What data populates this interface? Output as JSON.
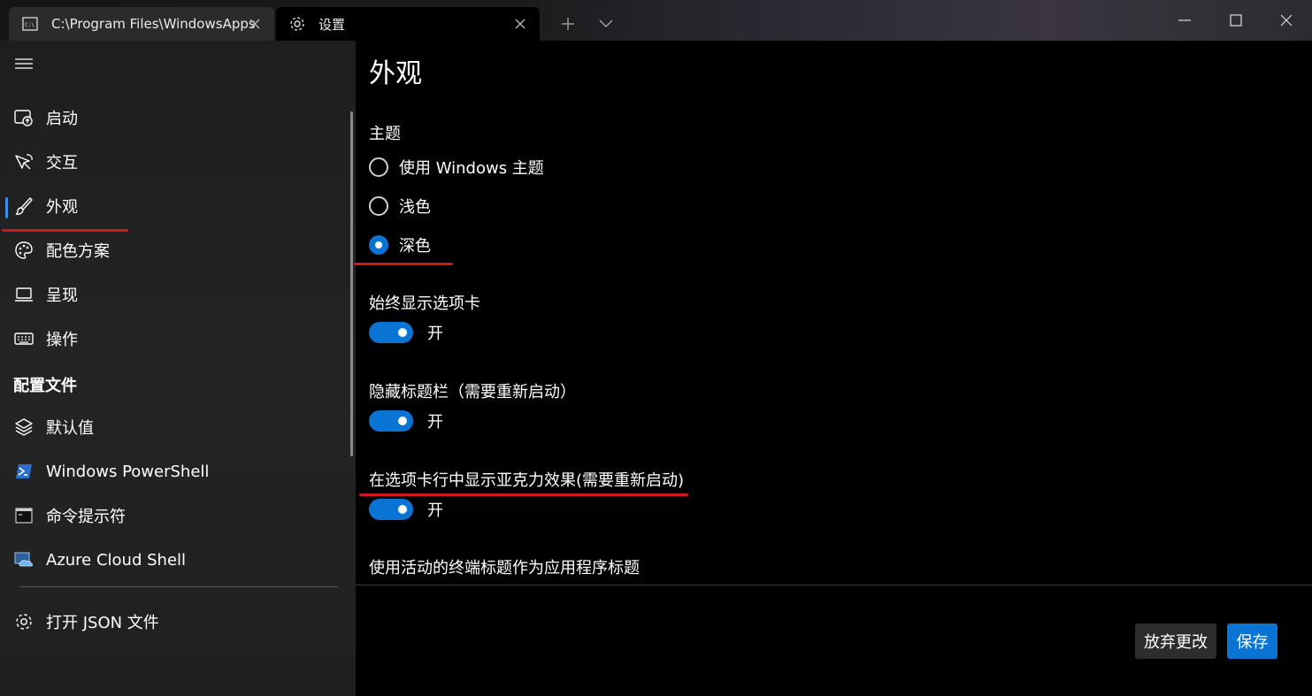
{
  "titlebar": {
    "tabs": [
      {
        "label": "C:\\Program Files\\WindowsApps",
        "icon": "terminal-icon"
      },
      {
        "label": "设置",
        "icon": "gear-icon"
      }
    ],
    "new_tab_icon": "plus-icon",
    "dropdown_icon": "chevron-down-icon",
    "window_controls": [
      "minimize-icon",
      "maximize-icon",
      "close-icon"
    ]
  },
  "sidebar": {
    "menu_icon": "hamburger-icon",
    "items": [
      {
        "label": "启动",
        "icon": "startup-icon"
      },
      {
        "label": "交互",
        "icon": "interaction-icon"
      },
      {
        "label": "外观",
        "icon": "brush-icon",
        "selected": true
      },
      {
        "label": "配色方案",
        "icon": "palette-icon"
      },
      {
        "label": "呈现",
        "icon": "laptop-icon"
      },
      {
        "label": "操作",
        "icon": "keyboard-icon"
      }
    ],
    "profiles_header": "配置文件",
    "profiles": [
      {
        "label": "默认值",
        "icon": "layers-icon"
      },
      {
        "label": "Windows PowerShell",
        "icon": "powershell-icon"
      },
      {
        "label": "命令提示符",
        "icon": "cmd-icon"
      },
      {
        "label": "Azure Cloud Shell",
        "icon": "azure-cloud-icon"
      }
    ],
    "open_json": {
      "label": "打开 JSON 文件",
      "icon": "gear-icon"
    }
  },
  "main": {
    "title": "外观",
    "theme": {
      "label": "主题",
      "options": [
        {
          "label": "使用 Windows 主题",
          "checked": false
        },
        {
          "label": "浅色",
          "checked": false
        },
        {
          "label": "深色",
          "checked": true
        }
      ]
    },
    "settings": [
      {
        "label": "始终显示选项卡",
        "state": "开"
      },
      {
        "label": "隐藏标题栏（需要重新启动）",
        "state": "开"
      },
      {
        "label": "在选项卡行中显示亚克力效果(需要重新启动)",
        "state": "开"
      },
      {
        "label": "使用活动的终端标题作为应用程序标题"
      }
    ],
    "buttons": {
      "discard": "放弃更改",
      "save": "保存"
    }
  },
  "colors": {
    "accent": "#0a74d4",
    "annotation": "#d4151b",
    "background": "#000000",
    "sidebar": "#202020"
  }
}
